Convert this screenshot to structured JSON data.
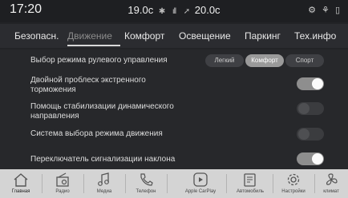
{
  "status": {
    "time": "17:20",
    "temp_left": "19.0c",
    "temp_right": "20.0c",
    "right_icons": "⚙ ⚘ ▯"
  },
  "tabs": [
    {
      "label": "Безопасн."
    },
    {
      "label": "Движение"
    },
    {
      "label": "Комфорт"
    },
    {
      "label": "Освещение"
    },
    {
      "label": "Паркинг"
    },
    {
      "label": "Тех.инфо"
    }
  ],
  "settings": {
    "steering_label": "Выбор режима рулевого управления",
    "steering_options": [
      "Легкий",
      "Комфорт",
      "Спорт"
    ],
    "steering_selected": "Комфорт",
    "hazard_label": "Двойной проблеск экстренного торможения",
    "hazard_on": true,
    "stability_label": "Помощь стабилизации динамического направления",
    "stability_on": false,
    "drive_mode_label": "Система выбора режима движения",
    "drive_mode_on": false,
    "tilt_label": "Переключатель сигнализации наклона",
    "tilt_on": true
  },
  "bottom_nav": [
    {
      "label": "Главная",
      "icon": "home-icon"
    },
    {
      "label": "Радио",
      "icon": "radio-icon"
    },
    {
      "label": "Медиа",
      "icon": "music-icon"
    },
    {
      "label": "Телефон",
      "icon": "phone-icon"
    },
    {
      "label": "Apple CarPlay",
      "icon": "carplay-icon"
    },
    {
      "label": "Автомобиль",
      "icon": "car-settings-icon"
    },
    {
      "label": "Настройки",
      "icon": "gear-icon"
    },
    {
      "label": "климат",
      "icon": "fan-icon"
    }
  ]
}
